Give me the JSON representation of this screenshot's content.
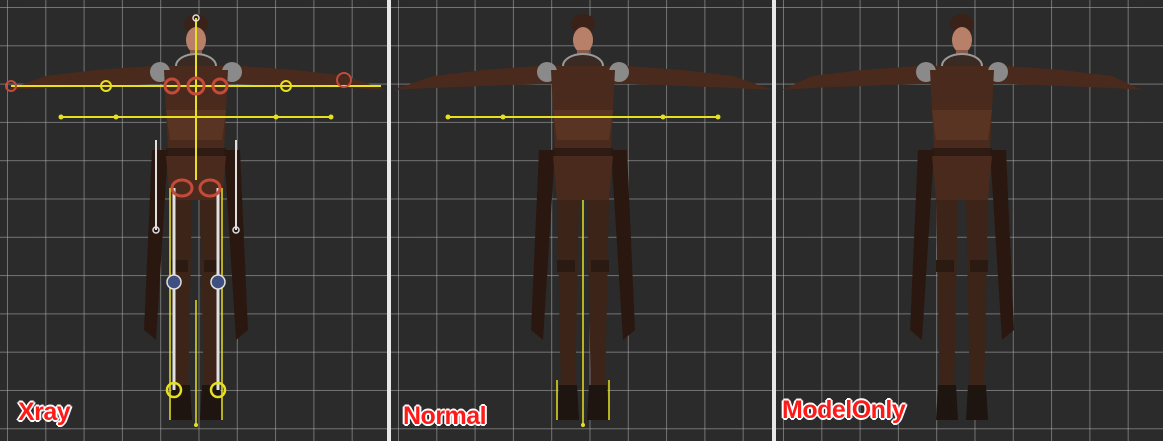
{
  "viewports": [
    {
      "label": "Xray",
      "mode": "xray",
      "show_bones": true,
      "show_ground_line": true
    },
    {
      "label": "Normal",
      "mode": "normal",
      "show_bones": false,
      "show_ground_line": true
    },
    {
      "label": "ModelOnly",
      "mode": "model-only",
      "show_bones": false,
      "show_ground_line": false
    }
  ],
  "colors": {
    "viewport_bg": "#2b2b2b",
    "grid_line": "#afafaf",
    "label_text": "#ff1a1a",
    "label_outline": "#ffffff",
    "bone_yellow": "#e6e020",
    "bone_white": "#e0e0e0",
    "joint_red": "#c44a3a",
    "armor_brown": "#4a2a1c",
    "skin": "#b88068"
  }
}
